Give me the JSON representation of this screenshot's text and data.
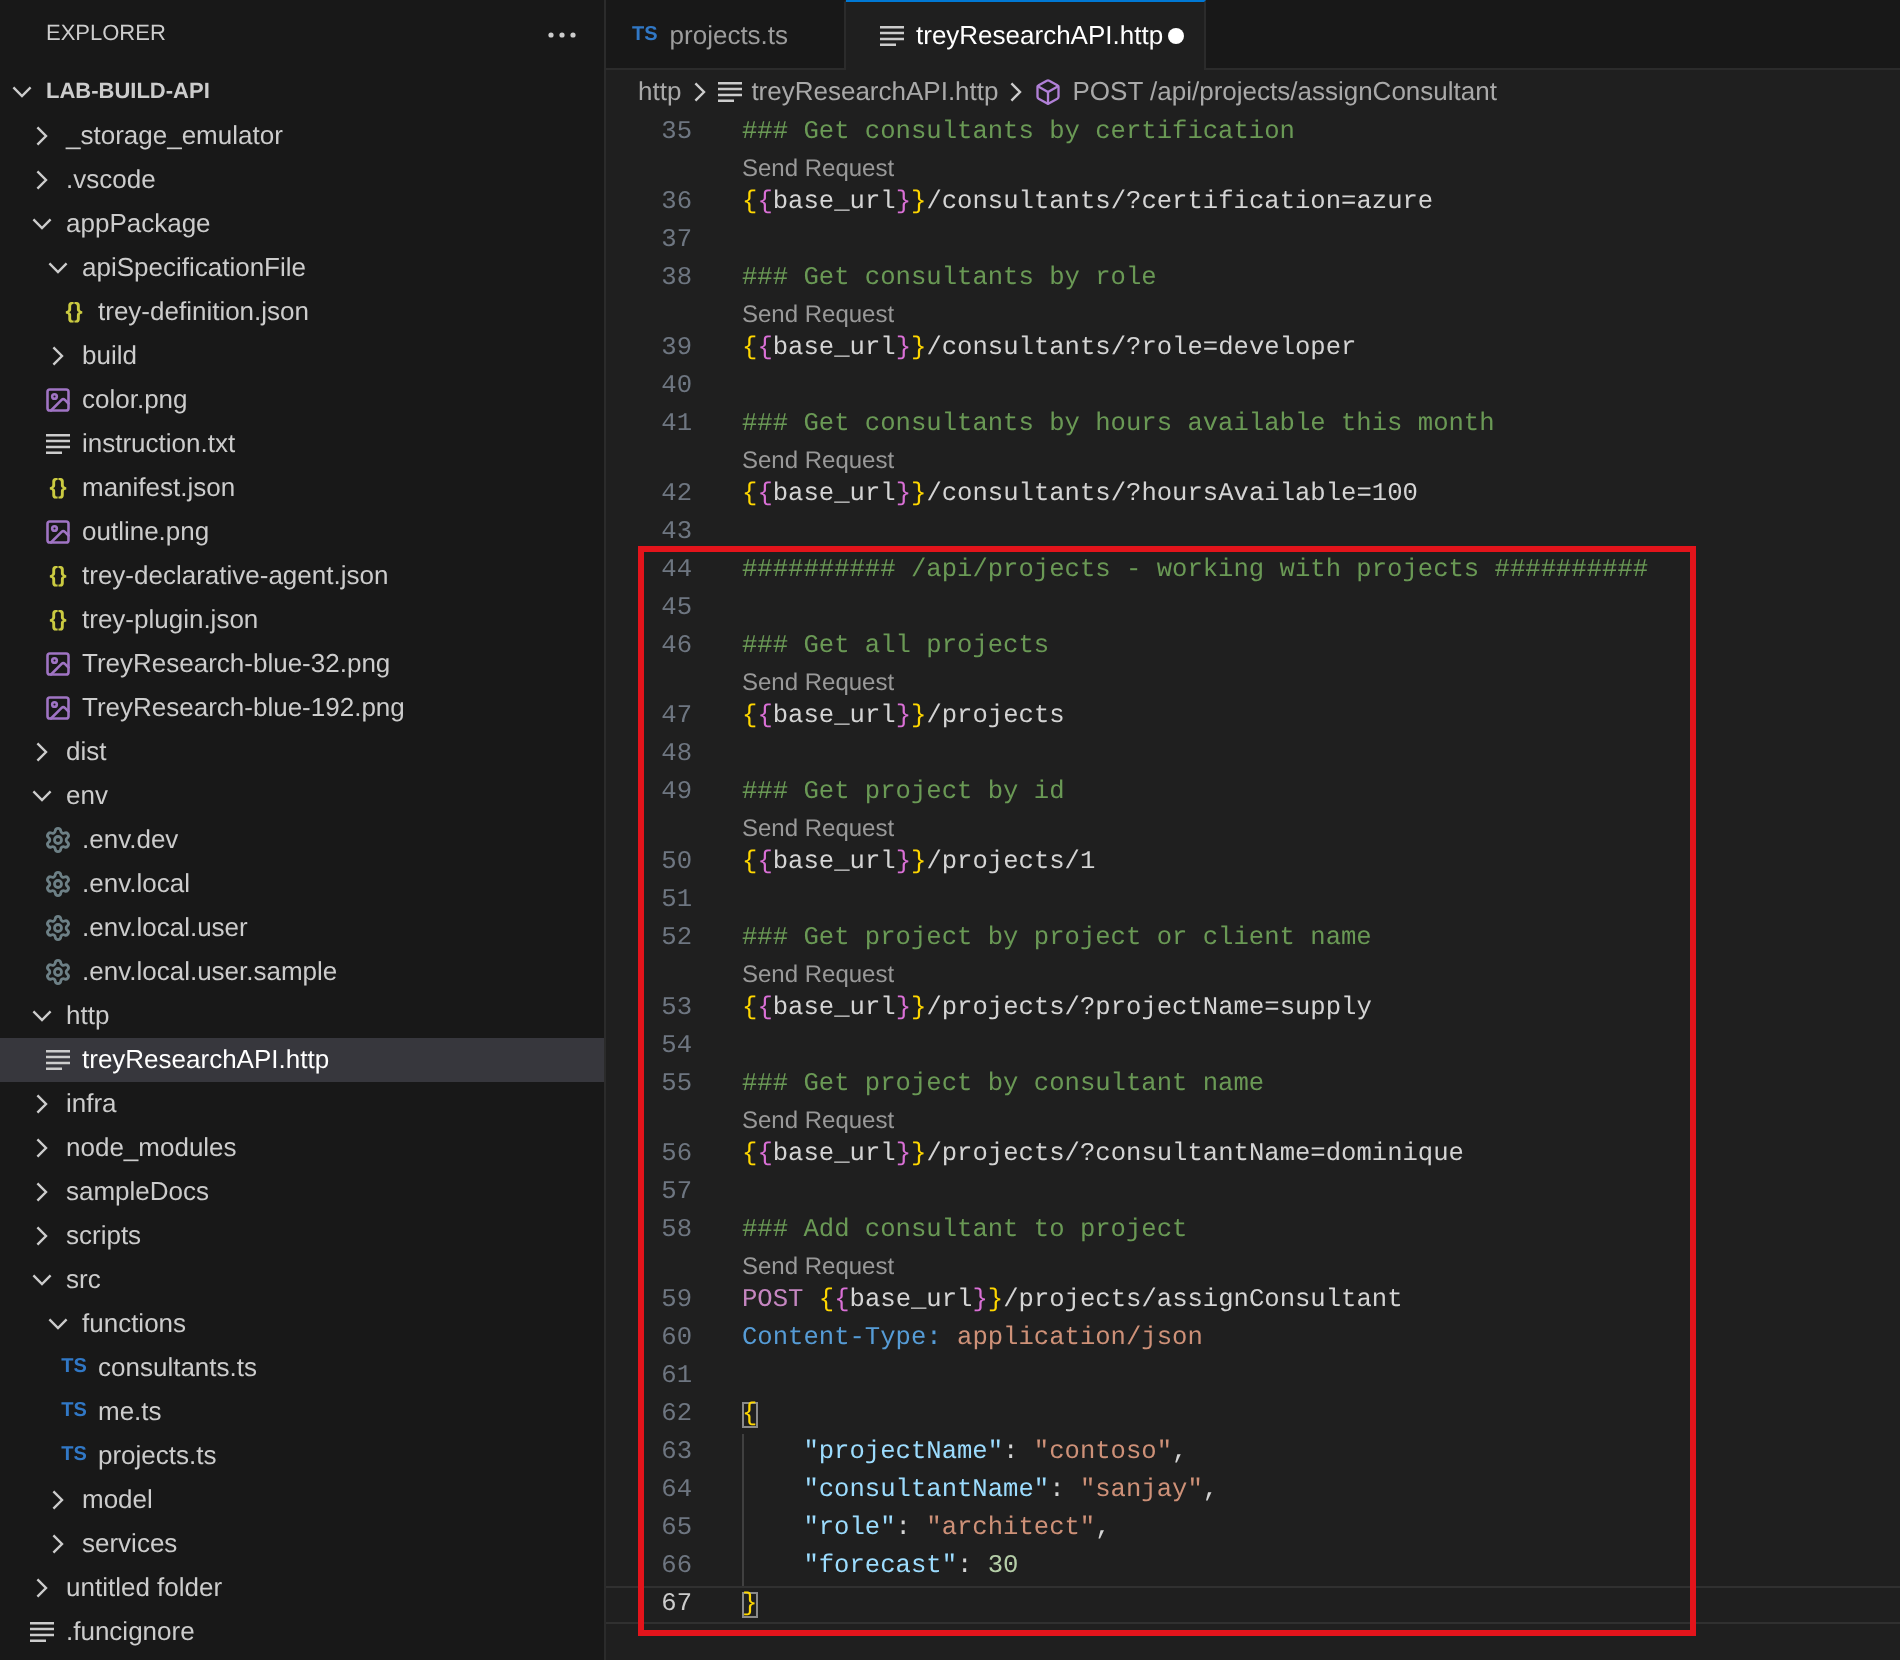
{
  "explorer": {
    "title": "EXPLORER",
    "workspace": {
      "label": "LAB-BUILD-API",
      "expanded": true,
      "children": [
        {
          "label": "_storage_emulator",
          "kind": "folder",
          "expanded": false,
          "selected": false
        },
        {
          "label": ".vscode",
          "kind": "folder",
          "expanded": false,
          "selected": false
        },
        {
          "label": "appPackage",
          "kind": "folder",
          "expanded": true,
          "selected": false,
          "children": [
            {
              "label": "apiSpecificationFile",
              "kind": "folder",
              "expanded": true,
              "selected": false,
              "children": [
                {
                  "label": "trey-definition.json",
                  "kind": "json",
                  "icon_text": "{}",
                  "selected": false
                }
              ]
            },
            {
              "label": "build",
              "kind": "folder",
              "expanded": false,
              "selected": false
            },
            {
              "label": "color.png",
              "kind": "image",
              "selected": false
            },
            {
              "label": "instruction.txt",
              "kind": "text",
              "selected": false
            },
            {
              "label": "manifest.json",
              "kind": "json",
              "icon_text": "{}",
              "selected": false
            },
            {
              "label": "outline.png",
              "kind": "image",
              "selected": false
            },
            {
              "label": "trey-declarative-agent.json",
              "kind": "json",
              "icon_text": "{}",
              "selected": false
            },
            {
              "label": "trey-plugin.json",
              "kind": "json",
              "icon_text": "{}",
              "selected": false
            },
            {
              "label": "TreyResearch-blue-32.png",
              "kind": "image",
              "selected": false
            },
            {
              "label": "TreyResearch-blue-192.png",
              "kind": "image",
              "selected": false
            }
          ]
        },
        {
          "label": "dist",
          "kind": "folder",
          "expanded": false,
          "selected": false
        },
        {
          "label": "env",
          "kind": "folder",
          "expanded": true,
          "selected": false,
          "children": [
            {
              "label": ".env.dev",
              "kind": "settings",
              "selected": false
            },
            {
              "label": ".env.local",
              "kind": "settings",
              "selected": false
            },
            {
              "label": ".env.local.user",
              "kind": "settings",
              "selected": false
            },
            {
              "label": ".env.local.user.sample",
              "kind": "settings",
              "selected": false
            }
          ]
        },
        {
          "label": "http",
          "kind": "folder",
          "expanded": true,
          "selected": false,
          "children": [
            {
              "label": "treyResearchAPI.http",
              "kind": "text",
              "selected": true
            }
          ]
        },
        {
          "label": "infra",
          "kind": "folder",
          "expanded": false,
          "selected": false
        },
        {
          "label": "node_modules",
          "kind": "folder",
          "expanded": false,
          "selected": false
        },
        {
          "label": "sampleDocs",
          "kind": "folder",
          "expanded": false,
          "selected": false
        },
        {
          "label": "scripts",
          "kind": "folder",
          "expanded": false,
          "selected": false
        },
        {
          "label": "src",
          "kind": "folder",
          "expanded": true,
          "selected": false,
          "children": [
            {
              "label": "functions",
              "kind": "folder",
              "expanded": true,
              "selected": false,
              "children": [
                {
                  "label": "consultants.ts",
                  "kind": "typescript",
                  "icon_text": "TS",
                  "selected": false
                },
                {
                  "label": "me.ts",
                  "kind": "typescript",
                  "icon_text": "TS",
                  "selected": false
                },
                {
                  "label": "projects.ts",
                  "kind": "typescript",
                  "icon_text": "TS",
                  "selected": false
                }
              ]
            },
            {
              "label": "model",
              "kind": "folder",
              "expanded": false,
              "selected": false
            },
            {
              "label": "services",
              "kind": "folder",
              "expanded": false,
              "selected": false
            }
          ]
        },
        {
          "label": "untitled folder",
          "kind": "folder",
          "expanded": false,
          "selected": false
        },
        {
          "label": ".funcignore",
          "kind": "text",
          "selected": false
        }
      ]
    }
  },
  "tabs": [
    {
      "label": "projects.ts",
      "kind": "typescript",
      "icon_text": "TS",
      "selected": false,
      "modified": false
    },
    {
      "label": "treyResearchAPI.http",
      "kind": "text",
      "selected": true,
      "modified": true
    }
  ],
  "breadcrumb": [
    {
      "label": "http",
      "kind": "folder"
    },
    {
      "label": "treyResearchAPI.http",
      "kind": "text"
    },
    {
      "label": "POST /api/projects/assignConsultant",
      "kind": "symbol"
    }
  ],
  "editor": {
    "lines": [
      {
        "number": "35",
        "current": false,
        "framed": false,
        "tokens": [
          {
            "kind": "comment",
            "text": "### Get consultants by certification"
          }
        ]
      },
      {
        "number": "36",
        "current": false,
        "framed": false,
        "codelens": "Send Request",
        "tokens": [
          {
            "kind": "bracket_outer",
            "text": "{"
          },
          {
            "kind": "bracket_inner",
            "text": "{"
          },
          {
            "kind": "variable",
            "text": "base_url"
          },
          {
            "kind": "bracket_inner",
            "text": "}"
          },
          {
            "kind": "bracket_outer",
            "text": "}"
          },
          {
            "kind": "plain",
            "text": "/consultants/?certification=azure"
          }
        ]
      },
      {
        "number": "37",
        "current": false,
        "framed": false
      },
      {
        "number": "38",
        "current": false,
        "framed": false,
        "tokens": [
          {
            "kind": "comment",
            "text": "### Get consultants by role"
          }
        ]
      },
      {
        "number": "39",
        "current": false,
        "framed": false,
        "codelens": "Send Request",
        "tokens": [
          {
            "kind": "bracket_outer",
            "text": "{"
          },
          {
            "kind": "bracket_inner",
            "text": "{"
          },
          {
            "kind": "variable",
            "text": "base_url"
          },
          {
            "kind": "bracket_inner",
            "text": "}"
          },
          {
            "kind": "bracket_outer",
            "text": "}"
          },
          {
            "kind": "plain",
            "text": "/consultants/?role=developer"
          }
        ]
      },
      {
        "number": "40",
        "current": false,
        "framed": false
      },
      {
        "number": "41",
        "current": false,
        "framed": false,
        "tokens": [
          {
            "kind": "comment",
            "text": "### Get consultants by hours available this month"
          }
        ]
      },
      {
        "number": "42",
        "current": false,
        "framed": false,
        "codelens": "Send Request",
        "tokens": [
          {
            "kind": "bracket_outer",
            "text": "{"
          },
          {
            "kind": "bracket_inner",
            "text": "{"
          },
          {
            "kind": "variable",
            "text": "base_url"
          },
          {
            "kind": "bracket_inner",
            "text": "}"
          },
          {
            "kind": "bracket_outer",
            "text": "}"
          },
          {
            "kind": "plain",
            "text": "/consultants/?hoursAvailable=100"
          }
        ]
      },
      {
        "number": "43",
        "current": false,
        "framed": false
      },
      {
        "number": "44",
        "current": false,
        "framed": true,
        "tokens": [
          {
            "kind": "comment",
            "text": "########## /api/projects - working with projects ##########"
          }
        ]
      },
      {
        "number": "45",
        "current": false,
        "framed": true
      },
      {
        "number": "46",
        "current": false,
        "framed": true,
        "tokens": [
          {
            "kind": "comment",
            "text": "### Get all projects"
          }
        ]
      },
      {
        "number": "47",
        "current": false,
        "framed": true,
        "codelens": "Send Request",
        "tokens": [
          {
            "kind": "bracket_outer",
            "text": "{"
          },
          {
            "kind": "bracket_inner",
            "text": "{"
          },
          {
            "kind": "variable",
            "text": "base_url"
          },
          {
            "kind": "bracket_inner",
            "text": "}"
          },
          {
            "kind": "bracket_outer",
            "text": "}"
          },
          {
            "kind": "plain",
            "text": "/projects"
          }
        ]
      },
      {
        "number": "48",
        "current": false,
        "framed": true
      },
      {
        "number": "49",
        "current": false,
        "framed": true,
        "tokens": [
          {
            "kind": "comment",
            "text": "### Get project by id"
          }
        ]
      },
      {
        "number": "50",
        "current": false,
        "framed": true,
        "codelens": "Send Request",
        "tokens": [
          {
            "kind": "bracket_outer",
            "text": "{"
          },
          {
            "kind": "bracket_inner",
            "text": "{"
          },
          {
            "kind": "variable",
            "text": "base_url"
          },
          {
            "kind": "bracket_inner",
            "text": "}"
          },
          {
            "kind": "bracket_outer",
            "text": "}"
          },
          {
            "kind": "plain",
            "text": "/projects/1"
          }
        ]
      },
      {
        "number": "51",
        "current": false,
        "framed": true
      },
      {
        "number": "52",
        "current": false,
        "framed": true,
        "tokens": [
          {
            "kind": "comment",
            "text": "### Get project by project or client name"
          }
        ]
      },
      {
        "number": "53",
        "current": false,
        "framed": true,
        "codelens": "Send Request",
        "tokens": [
          {
            "kind": "bracket_outer",
            "text": "{"
          },
          {
            "kind": "bracket_inner",
            "text": "{"
          },
          {
            "kind": "variable",
            "text": "base_url"
          },
          {
            "kind": "bracket_inner",
            "text": "}"
          },
          {
            "kind": "bracket_outer",
            "text": "}"
          },
          {
            "kind": "plain",
            "text": "/projects/?projectName=supply"
          }
        ]
      },
      {
        "number": "54",
        "current": false,
        "framed": true
      },
      {
        "number": "55",
        "current": false,
        "framed": true,
        "tokens": [
          {
            "kind": "comment",
            "text": "### Get project by consultant name"
          }
        ]
      },
      {
        "number": "56",
        "current": false,
        "framed": true,
        "codelens": "Send Request",
        "tokens": [
          {
            "kind": "bracket_outer",
            "text": "{"
          },
          {
            "kind": "bracket_inner",
            "text": "{"
          },
          {
            "kind": "variable",
            "text": "base_url"
          },
          {
            "kind": "bracket_inner",
            "text": "}"
          },
          {
            "kind": "bracket_outer",
            "text": "}"
          },
          {
            "kind": "plain",
            "text": "/projects/?consultantName=dominique"
          }
        ]
      },
      {
        "number": "57",
        "current": false,
        "framed": true
      },
      {
        "number": "58",
        "current": false,
        "framed": true,
        "tokens": [
          {
            "kind": "comment",
            "text": "### Add consultant to project"
          }
        ]
      },
      {
        "number": "59",
        "current": false,
        "framed": true,
        "codelens": "Send Request",
        "tokens": [
          {
            "kind": "method",
            "text": "POST "
          },
          {
            "kind": "bracket_outer",
            "text": "{"
          },
          {
            "kind": "bracket_inner",
            "text": "{"
          },
          {
            "kind": "variable",
            "text": "base_url"
          },
          {
            "kind": "bracket_inner",
            "text": "}"
          },
          {
            "kind": "bracket_outer",
            "text": "}"
          },
          {
            "kind": "plain",
            "text": "/projects/assignConsultant"
          }
        ]
      },
      {
        "number": "60",
        "current": false,
        "framed": true,
        "tokens": [
          {
            "kind": "header_name",
            "text": "Content-Type: "
          },
          {
            "kind": "header_value",
            "text": "application/json"
          }
        ]
      },
      {
        "number": "61",
        "current": false,
        "framed": true
      },
      {
        "number": "62",
        "current": false,
        "framed": true,
        "tokens": [
          {
            "kind": "bracket_outer",
            "text": "{",
            "matched": true
          }
        ]
      },
      {
        "number": "63",
        "current": false,
        "framed": true,
        "tokens": [
          {
            "kind": "indent"
          },
          {
            "kind": "key",
            "text": "\"projectName\""
          },
          {
            "kind": "plain",
            "text": ": "
          },
          {
            "kind": "string",
            "text": "\"contoso\""
          },
          {
            "kind": "plain",
            "text": ","
          }
        ]
      },
      {
        "number": "64",
        "current": false,
        "framed": true,
        "tokens": [
          {
            "kind": "indent"
          },
          {
            "kind": "key",
            "text": "\"consultantName\""
          },
          {
            "kind": "plain",
            "text": ": "
          },
          {
            "kind": "string",
            "text": "\"sanjay\""
          },
          {
            "kind": "plain",
            "text": ","
          }
        ]
      },
      {
        "number": "65",
        "current": false,
        "framed": true,
        "tokens": [
          {
            "kind": "indent"
          },
          {
            "kind": "key",
            "text": "\"role\""
          },
          {
            "kind": "plain",
            "text": ": "
          },
          {
            "kind": "string",
            "text": "\"architect\""
          },
          {
            "kind": "plain",
            "text": ","
          }
        ]
      },
      {
        "number": "66",
        "current": false,
        "framed": true,
        "tokens": [
          {
            "kind": "indent"
          },
          {
            "kind": "key",
            "text": "\"forecast\""
          },
          {
            "kind": "plain",
            "text": ": "
          },
          {
            "kind": "number",
            "text": "30"
          }
        ]
      },
      {
        "number": "67",
        "current": true,
        "framed": true,
        "tokens": [
          {
            "kind": "bracket_outer",
            "text": "}",
            "matched": true
          }
        ]
      }
    ]
  }
}
